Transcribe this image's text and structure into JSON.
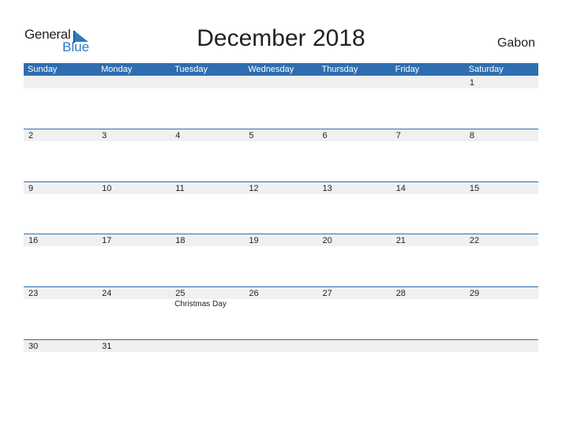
{
  "logo": {
    "general": "General",
    "blue": "Blue"
  },
  "title": "December 2018",
  "country": "Gabon",
  "accent_color": "#2e6eb0",
  "days_of_week": [
    "Sunday",
    "Monday",
    "Tuesday",
    "Wednesday",
    "Thursday",
    "Friday",
    "Saturday"
  ],
  "weeks": [
    [
      "",
      "",
      "",
      "",
      "",
      "",
      "1"
    ],
    [
      "2",
      "3",
      "4",
      "5",
      "6",
      "7",
      "8"
    ],
    [
      "9",
      "10",
      "11",
      "12",
      "13",
      "14",
      "15"
    ],
    [
      "16",
      "17",
      "18",
      "19",
      "20",
      "21",
      "22"
    ],
    [
      "23",
      "24",
      "25",
      "26",
      "27",
      "28",
      "29"
    ],
    [
      "30",
      "31",
      "",
      "",
      "",
      "",
      ""
    ]
  ],
  "events": [
    {
      "week": 4,
      "day": 2,
      "label": "Christmas Day"
    }
  ]
}
